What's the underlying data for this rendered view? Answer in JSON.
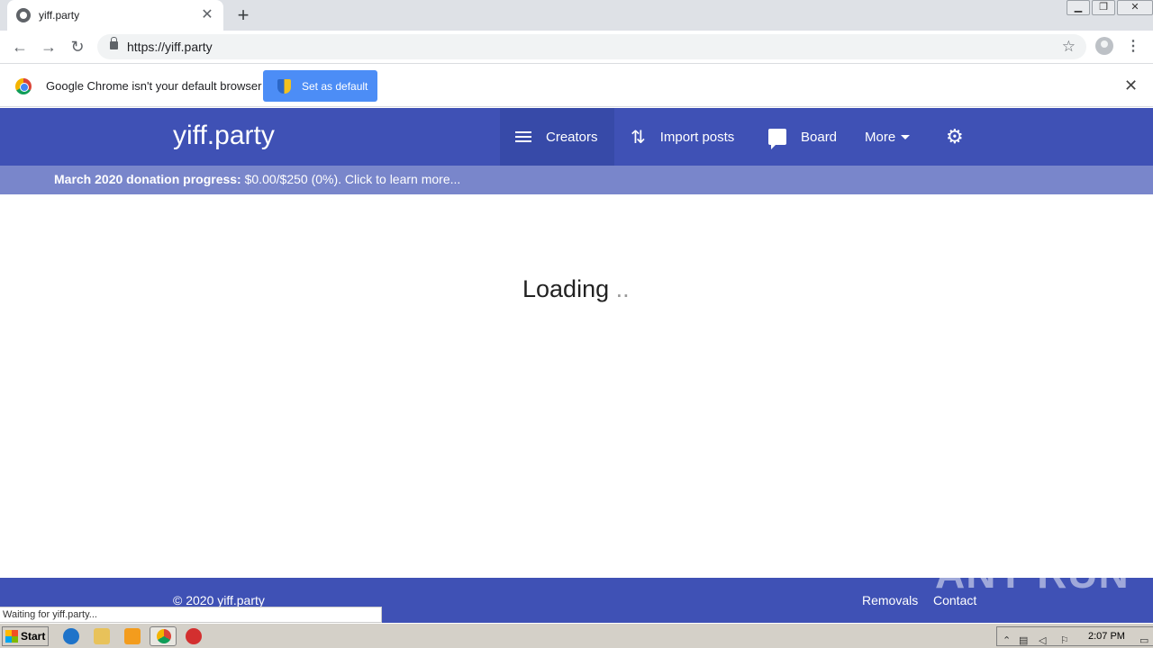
{
  "browser": {
    "tab_title": "yiff.party",
    "tab_close": "✕",
    "new_tab": "+",
    "url": "https://yiff.party",
    "infobar_text": "Google Chrome isn't your default browser",
    "set_default_label": "Set as default",
    "infobar_close": "✕",
    "status": "Waiting for yiff.party..."
  },
  "site": {
    "brand": "yiff.party",
    "nav": [
      {
        "label": "Creators",
        "icon": "list-icon"
      },
      {
        "label": "Import posts",
        "icon": "import-arrows-icon"
      },
      {
        "label": "Board",
        "icon": "chat-icon"
      },
      {
        "label": "More",
        "icon": "caret-down-icon"
      }
    ],
    "settings_icon": "gear-icon",
    "donation_bold": "March 2020 donation progress:",
    "donation_rest": " $0.00/$250 (0%). Click to learn more...",
    "loading": "Loading",
    "loading_dots": " ..",
    "footer_copy": "© 2020 yiff.party",
    "footer_links": [
      "Removals",
      "Contact"
    ]
  },
  "watermark": "ANY RUN",
  "taskbar": {
    "start": "Start",
    "time": "2:07 PM"
  },
  "colors": {
    "primary": "#3f51b5",
    "donation_bar": "#7986cb",
    "chrome_blue": "#4c8df6"
  }
}
